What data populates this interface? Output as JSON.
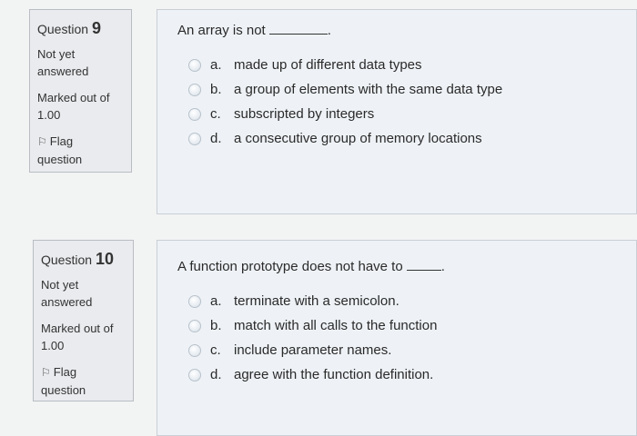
{
  "questions": [
    {
      "label": "Question",
      "number": "9",
      "state": [
        "Not yet",
        "answered"
      ],
      "marks": [
        "Marked out of",
        "1.00"
      ],
      "flag": [
        "Flag",
        "question"
      ],
      "text": "An array is not",
      "blank_suffix": ".",
      "answers": [
        {
          "letter": "a.",
          "text": "made up of different data types"
        },
        {
          "letter": "b.",
          "text": "a group of elements with the same data type"
        },
        {
          "letter": "c.",
          "text": "subscripted by integers"
        },
        {
          "letter": "d.",
          "text": "a consecutive group of memory locations"
        }
      ]
    },
    {
      "label": "Question",
      "number": "10",
      "state": [
        "Not yet",
        "answered"
      ],
      "marks": [
        "Marked out of",
        "1.00"
      ],
      "flag": [
        "Flag",
        "question"
      ],
      "text": "A function prototype does not have to",
      "blank_suffix": ".",
      "answers": [
        {
          "letter": "a.",
          "text": "terminate with a semicolon."
        },
        {
          "letter": "b.",
          "text": "match with all calls to the function"
        },
        {
          "letter": "c.",
          "text": "include parameter names."
        },
        {
          "letter": "d.",
          "text": "agree with the function definition."
        }
      ]
    }
  ]
}
